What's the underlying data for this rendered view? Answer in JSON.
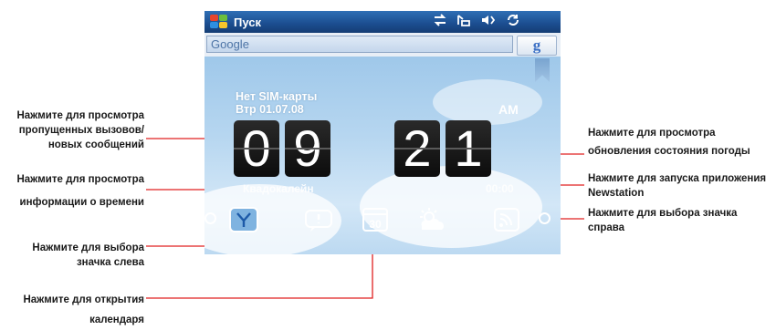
{
  "device": {
    "title_bar": {
      "start_label": "Пуск",
      "tray_icons": [
        "connectivity-icon",
        "signal-icon",
        "volume-icon",
        "sync-icon"
      ]
    },
    "search": {
      "value": "Google",
      "button_label": "g"
    },
    "home": {
      "status_line_1": "Нет SIM-карты",
      "status_line_2": "Втр 01.07.08",
      "ampm": "AM",
      "time_digits": [
        "0",
        "9",
        "2",
        "1"
      ],
      "location": "Квадокалейн",
      "temperature": "00:00"
    },
    "icon_bar": [
      "left-arrow-icon",
      "clock-tab-icon",
      "messages-tab-icon",
      "calendar-tab-icon",
      "weather-tab-icon",
      "rss-tab-icon",
      "right-arrow-icon"
    ]
  },
  "callouts": {
    "missed_calls": [
      "Нажмите для просмотра",
      "пропущенных вызовов/",
      "новых сообщений"
    ],
    "time_info": [
      "Нажмите для просмотра",
      "информации о времени"
    ],
    "select_left": [
      "Нажмите для выбора",
      "значка слева"
    ],
    "calendar": [
      "Нажмите для открытия",
      "календаря"
    ],
    "weather": [
      "Нажмите для просмотра",
      "обновления состояния погоды"
    ],
    "newstation": [
      "Нажмите для запуска приложения",
      "Newstation"
    ],
    "select_right": [
      "Нажмите для выбора значка",
      "справа"
    ]
  },
  "colors": {
    "leader_line": "#e02020",
    "title_bar": "#1b4d8f",
    "sky": "#b6d6f0"
  }
}
